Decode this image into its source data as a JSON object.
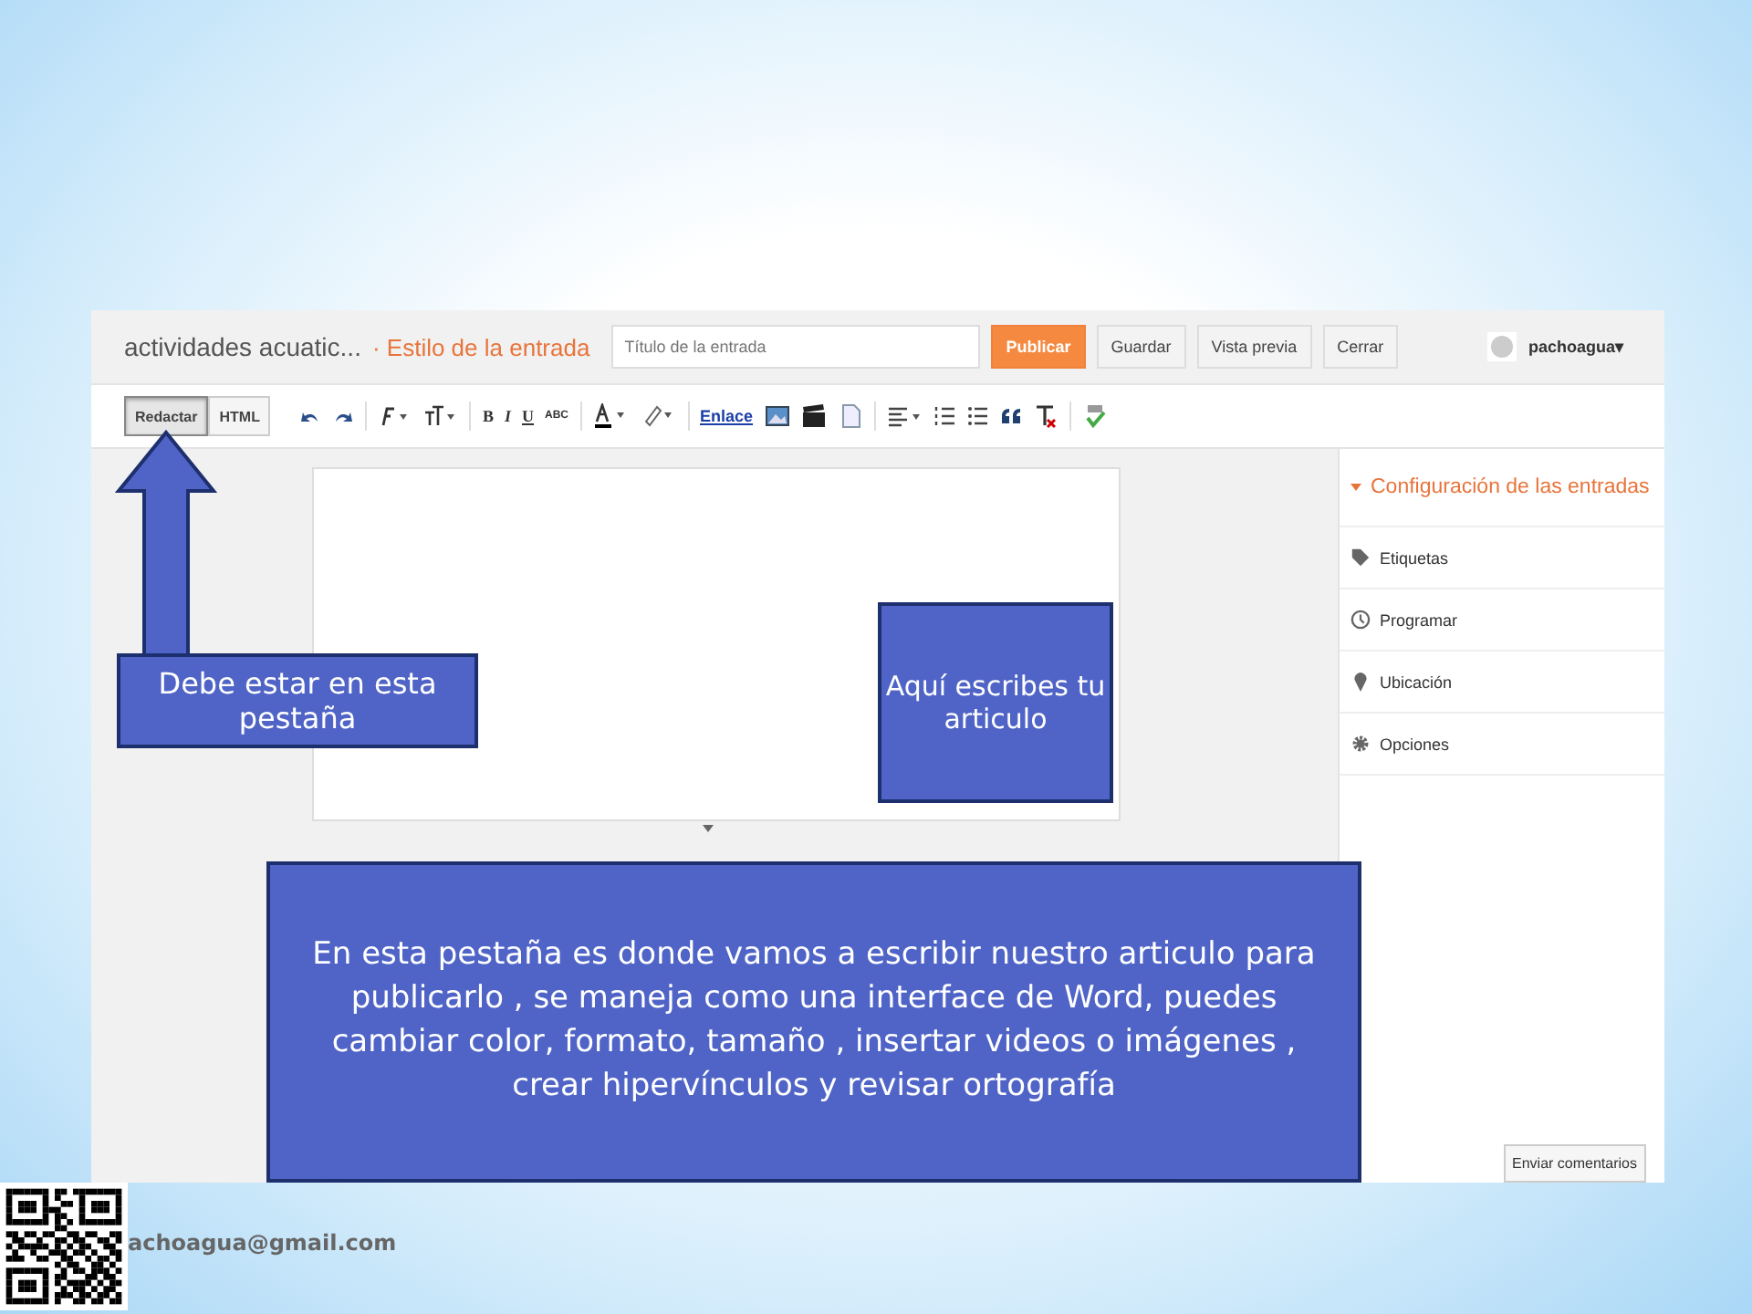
{
  "header": {
    "blog_name": "actividades acuatic...",
    "separator": "·",
    "page_title": "Estilo de la entrada",
    "title_field": {
      "placeholder": "Título de la entrada"
    },
    "buttons": [
      {
        "label": "Publicar",
        "kind": "primary"
      },
      {
        "label": "Guardar",
        "kind": "plain"
      },
      {
        "label": "Vista previa",
        "kind": "plain"
      },
      {
        "label": "Cerrar",
        "kind": "plain"
      }
    ],
    "user": "pachoagua▾"
  },
  "toolbar": {
    "mode_tabs": [
      {
        "label": "Redactar",
        "selected": true
      },
      {
        "label": "HTML",
        "selected": false
      }
    ],
    "bold": "B",
    "italic": "I",
    "underline": "U",
    "strike": "ABC",
    "link": "Enlace"
  },
  "sidebar": {
    "title": "Configuración de las entradas",
    "items": [
      {
        "label": "Etiquetas",
        "kind": "tag"
      },
      {
        "label": "Programar",
        "kind": "clock"
      },
      {
        "label": "Ubicación",
        "kind": "pin"
      },
      {
        "label": "Opciones",
        "kind": "gear"
      }
    ]
  },
  "feedback_button": "Enviar comentarios",
  "callouts": [
    {
      "text": "Debe estar en esta pestaña",
      "kind": "tab"
    },
    {
      "text": "Aquí escribes tu articulo",
      "kind": "editor"
    },
    {
      "text": "En esta pestaña es donde vamos a escribir nuestro articulo para publicarlo , se maneja como una interface de Word, puedes cambiar color, formato, tamaño , insertar videos  o imágenes , crear hipervínculos  y revisar ortografía",
      "kind": "note"
    }
  ],
  "footer": {
    "email": "achoagua@gmail.com"
  }
}
